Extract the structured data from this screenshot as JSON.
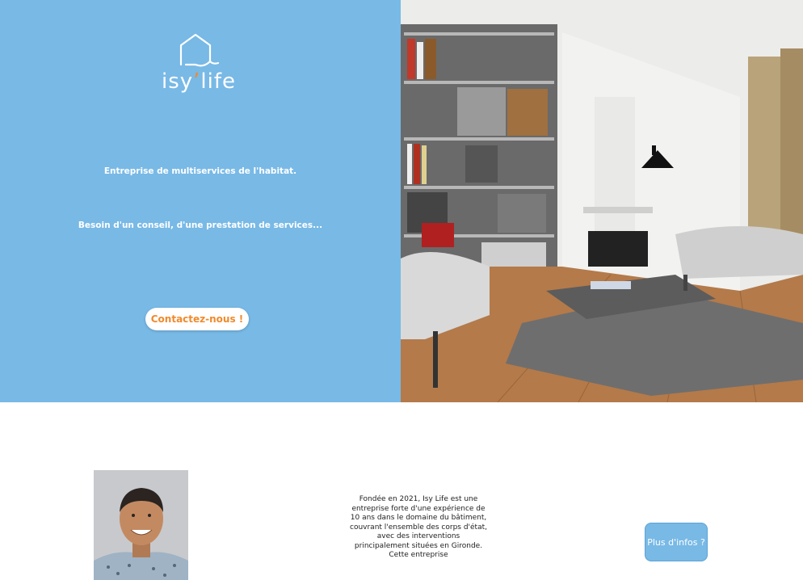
{
  "brand": {
    "name_left": "isy",
    "name_right": "life",
    "accent_color": "#f08a2c",
    "hero_color": "#78b9e6",
    "logo_icon": "house-outline-icon"
  },
  "hero": {
    "tagline_1": "Entreprise de multiservices de l'habitat.",
    "tagline_2": "Besoin d'un conseil, d'une prestation de services...",
    "cta_label": "Contactez-nous !",
    "image": "living-room-photo"
  },
  "about": {
    "portrait": "founder-portrait-photo",
    "text": "Fondée en 2021, Isy Life est une entreprise forte d'une expérience de 10 ans dans le domaine du bâtiment, couvrant l'ensemble des corps d'état, avec des interventions principalement situées en Gironde. Cette entreprise",
    "more_label": "Plus d'infos ?"
  }
}
